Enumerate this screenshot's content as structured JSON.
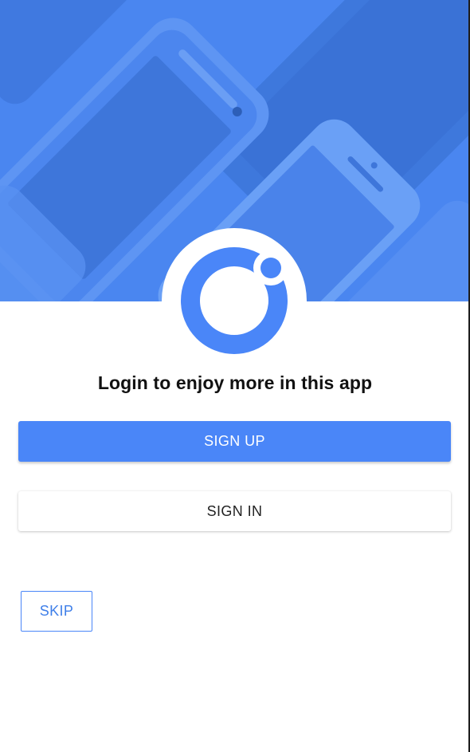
{
  "hero": {
    "background_color": "#4a86f0",
    "image": "phones-background"
  },
  "logo": {
    "icon": "ionic-logo-icon",
    "color": "#4a86f8"
  },
  "tagline": "Login to enjoy more in this app",
  "buttons": {
    "signup_label": "SIGN UP",
    "signin_label": "SIGN IN",
    "skip_label": "SKIP"
  },
  "colors": {
    "primary": "#4a86f8",
    "text_dark": "#111111"
  }
}
